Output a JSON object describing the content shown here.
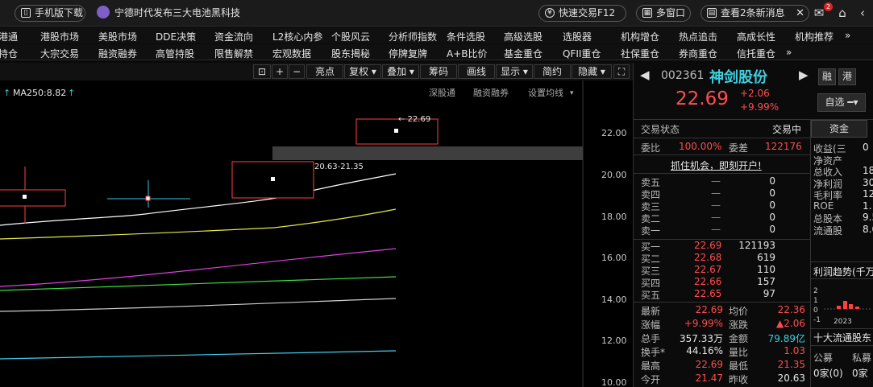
{
  "topbar": {
    "mobile_label": "手机版下载",
    "news_headline": "宁德时代发布三大电池黑科技",
    "quick_trade": "快速交易F12",
    "multi_window": "多窗口",
    "messages": "查看2条新消息",
    "mail_badge": "2"
  },
  "menu_row1": [
    "港通",
    "港股市场",
    "美股市场",
    "DDE决策",
    "资金流向",
    "L2核心内参",
    "个股风云",
    "分析师指数",
    "条件选股",
    "高级选股",
    "选股器",
    "机构增仓",
    "热点追击",
    "高成长性",
    "机构推荐",
    "»"
  ],
  "menu_row2": [
    "持仓",
    "大宗交易",
    "融资融券",
    "高管持股",
    "限售解禁",
    "宏观数据",
    "股东揭秘",
    "停牌复牌",
    "A+B比价",
    "基金重仓",
    "QFII重仓",
    "社保重仓",
    "券商重仓",
    "信托重仓",
    "»"
  ],
  "toolbar": {
    "buttons": [
      "亮点",
      "复权",
      "叠加",
      "筹码",
      "画线",
      "显示",
      "简约",
      "隐藏"
    ],
    "sub_links": [
      "深股通",
      "融资融券",
      "设置均线"
    ]
  },
  "chart": {
    "ma_label": "MA250:8.82",
    "price_max_label": "22.69",
    "range_label": "20.63-21.35",
    "y_ticks": [
      "22.00",
      "20.00",
      "18.00",
      "16.00",
      "14.00",
      "12.00",
      "10.00"
    ],
    "colors": {
      "ma_white": "#ffffff",
      "ma_yellow": "#e8e84a",
      "ma_magenta": "#e040e0",
      "ma_green": "#40e040",
      "ma_gray": "#d0d0d0",
      "ma_cyan": "#40d0f0",
      "candle_red": "#ff4040",
      "crosshair": "#30c8e0"
    }
  },
  "stock": {
    "code": "002361",
    "name": "神剑股份",
    "tag1": "融",
    "tag2": "港",
    "price": "22.69",
    "change": "+2.06",
    "change_pct": "+9.99%",
    "select_label": "自选",
    "trade_status_label": "交易状态",
    "trade_status": "交易中",
    "fund_tab": "资金",
    "ratio_label": "委比",
    "ratio": "100.00%",
    "diff_label": "委差",
    "diff": "122176",
    "promo": "抓住机会，即刻开户!",
    "sells": [
      {
        "label": "卖五",
        "price": "—",
        "vol": "0"
      },
      {
        "label": "卖四",
        "price": "—",
        "vol": "0"
      },
      {
        "label": "卖三",
        "price": "—",
        "vol": "0"
      },
      {
        "label": "卖二",
        "price": "—",
        "vol": "0"
      },
      {
        "label": "卖一",
        "price": "—",
        "vol": "0"
      }
    ],
    "buys": [
      {
        "label": "买一",
        "price": "22.69",
        "vol": "121193"
      },
      {
        "label": "买二",
        "price": "22.68",
        "vol": "619"
      },
      {
        "label": "买三",
        "price": "22.67",
        "vol": "110"
      },
      {
        "label": "买四",
        "price": "22.66",
        "vol": "157"
      },
      {
        "label": "买五",
        "price": "22.65",
        "vol": "97"
      }
    ],
    "stats": [
      {
        "l1": "最新",
        "v1": "22.69",
        "l2": "均价",
        "v2": "22.36"
      },
      {
        "l1": "涨幅",
        "v1": "+9.99%",
        "l2": "涨跌",
        "v2": "▲2.06"
      },
      {
        "l1": "总手",
        "v1": "357.33万",
        "l2": "金额",
        "v2": "79.89亿"
      },
      {
        "l1": "换手*",
        "v1": "44.16%",
        "l2": "量比",
        "v2": "1.03"
      },
      {
        "l1": "最高",
        "v1": "22.69",
        "l2": "最低",
        "v2": "21.35"
      },
      {
        "l1": "今开",
        "v1": "21.47",
        "l2": "昨收",
        "v2": "20.63"
      }
    ],
    "fin_labels": [
      "收益(三",
      "净资产",
      "总收入",
      "净利润",
      "毛利率",
      "ROE",
      "总股本",
      "流通股"
    ],
    "fin_values": [
      "0",
      "",
      "18",
      "30",
      "12.",
      "1.",
      "9.5",
      "8.0"
    ],
    "profit_trend": "利润趋势(千万",
    "profit_axis": [
      "2",
      "1",
      "0",
      "-1",
      "-2"
    ],
    "profit_year": "2023",
    "top10": "十大流通股东",
    "public_fund": "公募",
    "private_fund": "私募",
    "pf_count": "0家(0)",
    "pv_count": "0家"
  }
}
